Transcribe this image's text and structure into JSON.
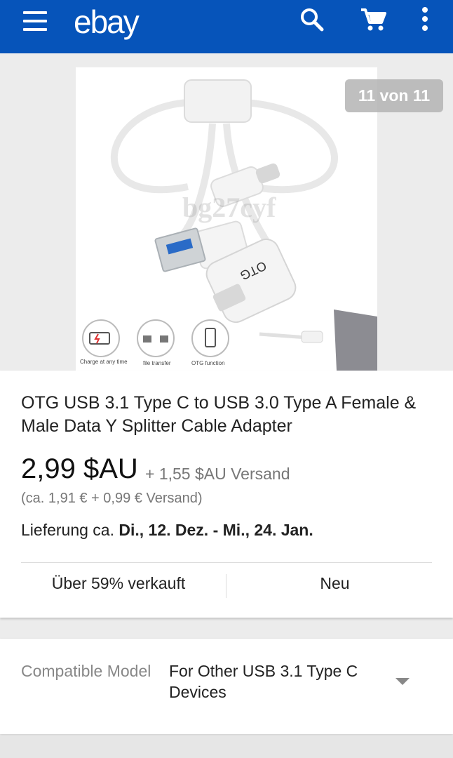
{
  "header": {
    "logo": "ebay",
    "brand_color": "#0654ba",
    "icons": [
      "menu-icon",
      "search-icon",
      "cart-icon",
      "more-vert-icon"
    ]
  },
  "gallery": {
    "counter": "11 von 11",
    "watermark": "bg27cyf",
    "product_label": "OTG",
    "features": [
      "Charge at any time",
      "file transfer",
      "OTG function"
    ]
  },
  "product": {
    "title": "OTG USB 3.1 Type C to USB 3.0 Type A Female & Male Data Y Splitter Cable Adapter",
    "price": "2,99 $AU",
    "shipping": "+ 1,55 $AU Versand",
    "converted": "(ca. 1,91 € + 0,99 € Versand)",
    "delivery_prefix": "Lieferung ca. ",
    "delivery_dates": "Di., 12. Dez. - Mi., 24. Jan.",
    "sold": "Über 59% verkauft",
    "condition": "Neu"
  },
  "compat": {
    "label": "Compatible Model",
    "value": "For Other USB 3.1 Type C Devices"
  }
}
